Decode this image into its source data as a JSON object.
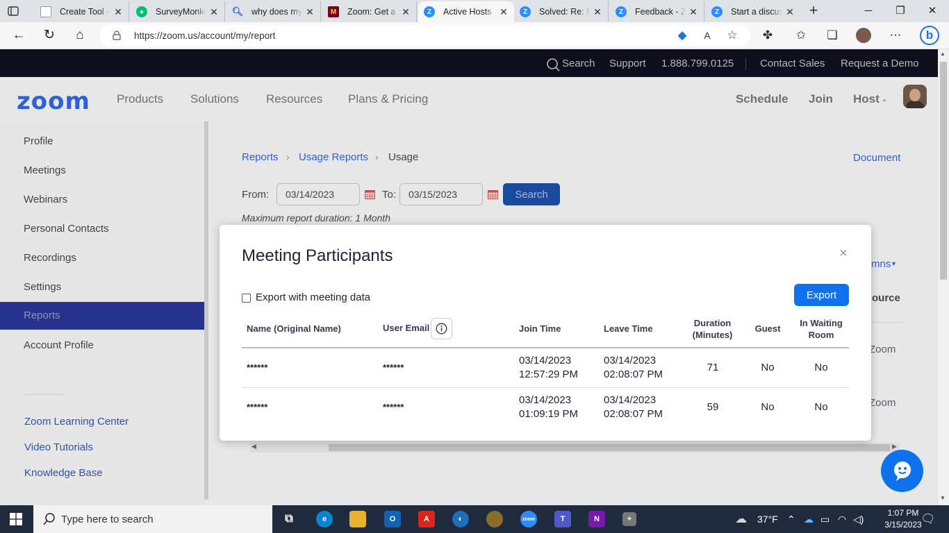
{
  "browser": {
    "tabs": [
      {
        "title": "Create Tool - ",
        "icon": "document-icon",
        "active": false
      },
      {
        "title": "SurveyMonkey",
        "icon": "surveymonkey-icon",
        "active": false
      },
      {
        "title": "why does my",
        "icon": "search-icon",
        "active": false
      },
      {
        "title": "Zoom: Get a ",
        "icon": "university-icon",
        "active": false
      },
      {
        "title": "Active Hosts ",
        "icon": "zoom-icon",
        "active": true
      },
      {
        "title": "Solved: Re: Pa",
        "icon": "zoom-icon",
        "active": false
      },
      {
        "title": "Feedback - Zo",
        "icon": "zoom-icon",
        "active": false
      },
      {
        "title": "Start a discuss",
        "icon": "zoom-icon",
        "active": false
      }
    ],
    "url": "https://zoom.us/account/my/report"
  },
  "topbar": {
    "search": "Search",
    "support": "Support",
    "phone": "1.888.799.0125",
    "contact_sales": "Contact Sales",
    "request_demo": "Request a Demo"
  },
  "nav": {
    "logo": "zoom",
    "products": "Products",
    "solutions": "Solutions",
    "resources": "Resources",
    "plans": "Plans & Pricing",
    "schedule": "Schedule",
    "join": "Join",
    "host": "Host"
  },
  "sidebar": {
    "items": [
      "Profile",
      "Meetings",
      "Webinars",
      "Personal Contacts",
      "Recordings",
      "Settings",
      "Reports",
      "Account Profile"
    ],
    "links": [
      "Zoom Learning Center",
      "Video Tutorials",
      "Knowledge Base"
    ]
  },
  "page": {
    "crumbs": [
      "Reports",
      "Usage Reports",
      "Usage"
    ],
    "document": "Document",
    "from_label": "From:",
    "from_value": "03/14/2023",
    "to_label": "To:",
    "to_value": "03/15/2023",
    "search_btn": "Search",
    "max_note": "Maximum report duration: 1 Month",
    "behind_columns": "mns",
    "behind_source": "ource",
    "behind_row1": "Zoom",
    "behind_row2": "Zoom"
  },
  "modal": {
    "title": "Meeting Participants",
    "close": "×",
    "export_with_data": "Export with meeting data",
    "export_btn": "Export",
    "headers": {
      "name": "Name (Original Name)",
      "email": "User Email",
      "join": "Join Time",
      "leave": "Leave Time",
      "duration_1": "Duration",
      "duration_2": "(Minutes)",
      "guest": "Guest",
      "waiting_1": "In Waiting",
      "waiting_2": "Room"
    },
    "rows": [
      {
        "name": "******",
        "email": "******",
        "join_date": "03/14/2023",
        "join_time": "12:57:29 PM",
        "leave_date": "03/14/2023",
        "leave_time": "02:08:07 PM",
        "duration": "71",
        "guest": "No",
        "waiting": "No"
      },
      {
        "name": "******",
        "email": "******",
        "join_date": "03/14/2023",
        "join_time": "01:09:19 PM",
        "leave_date": "03/14/2023",
        "leave_time": "02:08:07 PM",
        "duration": "59",
        "guest": "No",
        "waiting": "No"
      }
    ]
  },
  "taskbar": {
    "search_placeholder": "Type here to search",
    "weather": "37°F",
    "time": "1:07 PM",
    "date": "3/15/2023"
  },
  "colors": {
    "zoom_blue": "#0e72ed",
    "sidebar_active": "#26328c",
    "topbar": "#0e0e1d"
  }
}
